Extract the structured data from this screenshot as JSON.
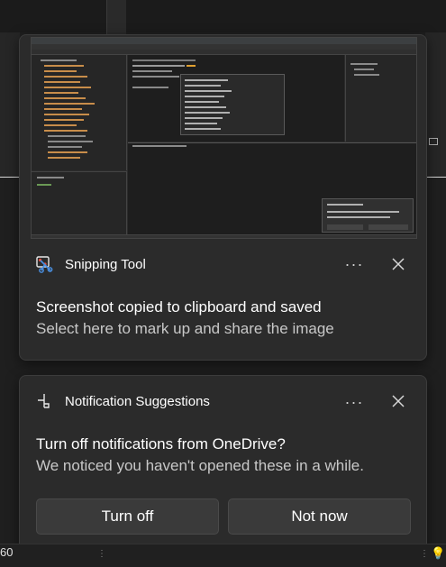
{
  "notifications": [
    {
      "app_name": "Snipping Tool",
      "app_icon": "snipping-tool-icon",
      "title": "Screenshot copied to clipboard and saved",
      "body": "Select here to mark up and share the image",
      "more_label": "···",
      "has_thumbnail": true
    },
    {
      "app_name": "Notification Suggestions",
      "app_icon": "notification-suggestions-icon",
      "title": "Turn off notifications from OneDrive?",
      "body": "We noticed you haven't opened these in a while.",
      "more_label": "···",
      "actions": [
        "Turn off",
        "Not now"
      ]
    }
  ],
  "taskbar": {
    "left_text": "60"
  },
  "colors": {
    "card_bg": "#2b2b2b",
    "button_bg": "#3a3a3a",
    "text_primary": "#ffffff",
    "text_secondary": "#c8c8c8",
    "accent_bulb": "#f2c94c"
  }
}
